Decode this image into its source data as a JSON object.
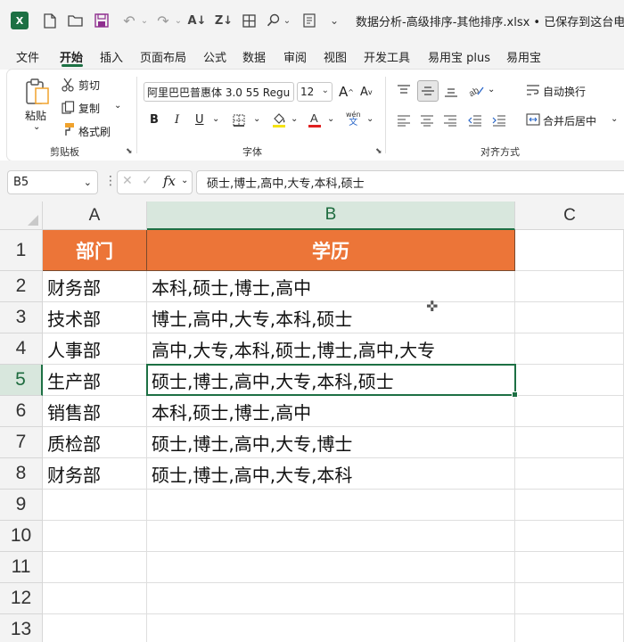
{
  "titlebar": {
    "title": "数据分析-高级排序-其他排序.xlsx • 已保存到这台电脑",
    "logo": "X"
  },
  "menu": [
    "文件",
    "开始",
    "插入",
    "页面布局",
    "公式",
    "数据",
    "审阅",
    "视图",
    "开发工具",
    "易用宝 plus",
    "易用宝"
  ],
  "ribbon": {
    "clipboard": {
      "paste": "粘贴",
      "cut": "剪切",
      "copy": "复制",
      "format_painter": "格式刷",
      "group": "剪贴板"
    },
    "font": {
      "font_name": "阿里巴巴普惠体 3.0 55 Regu",
      "font_size": "12",
      "bold": "B",
      "italic": "I",
      "underline": "U",
      "increase": "A",
      "decrease": "A",
      "wen": "wén",
      "wen_char": "文",
      "group": "字体"
    },
    "alignment": {
      "wrap": "自动换行",
      "merge": "合并后居中",
      "group": "对齐方式"
    }
  },
  "formula": {
    "name_box": "B5",
    "fx": "fx",
    "content": "硕士,博士,高中,大专,本科,硕士"
  },
  "columns": [
    "A",
    "B",
    "C"
  ],
  "rows": [
    "1",
    "2",
    "3",
    "4",
    "5",
    "6",
    "7",
    "8",
    "9",
    "10",
    "11",
    "12",
    "13"
  ],
  "table": {
    "headers": [
      "部门",
      "学历"
    ],
    "data": [
      [
        "财务部",
        "本科,硕士,博士,高中"
      ],
      [
        "技术部",
        "博士,高中,大专,本科,硕士"
      ],
      [
        "人事部",
        "高中,大专,本科,硕士,博士,高中,大专"
      ],
      [
        "生产部",
        "硕士,博士,高中,大专,本科,硕士"
      ],
      [
        "销售部",
        "本科,硕士,博士,高中"
      ],
      [
        "质检部",
        "硕士,博士,高中,大专,博士"
      ],
      [
        "财务部",
        "硕士,博士,高中,大专,本科"
      ]
    ]
  },
  "colors": {
    "header_fill": "#ec7538",
    "accent": "#1d7044"
  }
}
